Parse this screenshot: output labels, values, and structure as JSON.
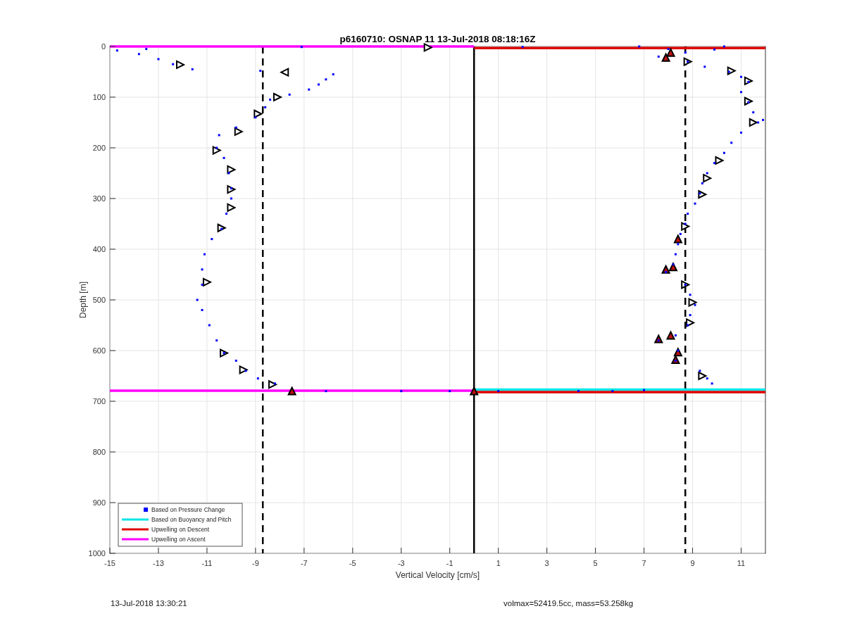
{
  "figure": {
    "chart_data": {
      "type": "scatter",
      "title": "p6160710: OSNAP 11 13-Jul-2018 08:18:16Z",
      "xlabel": "Vertical Velocity [cm/s]",
      "ylabel": "Depth [m]",
      "xlim": [
        -15,
        12
      ],
      "ylim": [
        1000,
        0
      ],
      "grid": true,
      "legend": true,
      "xticks": [
        -15,
        -13,
        -11,
        -9,
        -7,
        -5,
        -3,
        -1,
        1,
        3,
        5,
        7,
        9,
        11
      ],
      "yticks": [
        0,
        100,
        200,
        300,
        400,
        500,
        600,
        700,
        800,
        900,
        1000
      ],
      "x": [
        -15,
        0,
        0,
        12,
        0,
        12,
        0,
        12,
        -15,
        0,
        -1.9,
        -12.1,
        -8.1,
        -8.9,
        -9.7,
        -10.6,
        -10.0,
        -10.0,
        -10.0,
        -10.4,
        -11.0,
        -10.3,
        -9.5,
        -8.3,
        8.8,
        10.6,
        11.3,
        11.3,
        11.5,
        10.1,
        9.6,
        9.4,
        8.7,
        8.7,
        9.0,
        8.9,
        9.4,
        -7.8,
        -7.5,
        0,
        8.1,
        7.9,
        8.4,
        8.2,
        7.9,
        8.1,
        7.6,
        8.4,
        8.3,
        8.0,
        7.6,
        8.8,
        9.5,
        10.5,
        11.0,
        11.3,
        11.0,
        11.3,
        11.5,
        11.7,
        11.0,
        10.6,
        10.3,
        9.9,
        9.6,
        9.4,
        9.3,
        9.1,
        8.8,
        8.7,
        8.5,
        8.4,
        8.3,
        8.2,
        7.9,
        8.7,
        8.9,
        9.1,
        8.9,
        8.8,
        8.3,
        7.6,
        8.4,
        8.3,
        9.3,
        9.6,
        9.8,
        -8.2,
        -8.9,
        -9.4,
        -9.8,
        -10.3,
        -10.6,
        -10.9,
        -11.2,
        -11.4,
        -11.2,
        -11.2,
        -11.1,
        -10.8,
        -10.4,
        -10.2,
        -10.0,
        -10.0,
        -10.1,
        -10.3,
        -10.6,
        -10.5,
        -9.8,
        -9.0,
        -8.6,
        -8.4,
        -7.6,
        -6.8,
        -6.4,
        -6.1,
        -5.8,
        -11.6,
        -12.4,
        -13.0,
        -13.8,
        -14.7,
        -13.5,
        -6.1,
        -3.0,
        -1.0,
        1.0,
        4.3,
        5.7,
        7.0,
        -7.1,
        2.0,
        6.8,
        10.3,
        -8.8,
        8.7,
        9.9,
        11.9
      ],
      "series": [
        {
          "name": "Based on Pressure Change",
          "type": "scatter",
          "marker": "square",
          "color": "#0000ff",
          "values": [
            null,
            null,
            null,
            null,
            null,
            null,
            null,
            null,
            null,
            null,
            null,
            null,
            null,
            null,
            null,
            null,
            null,
            null,
            null,
            null,
            null,
            null,
            null,
            null,
            null,
            null,
            null,
            null,
            null,
            null,
            null,
            null,
            null,
            null,
            null,
            null,
            null,
            null,
            null,
            null,
            null,
            null,
            null,
            null,
            null,
            null,
            null,
            null,
            null,
            5,
            20,
            30,
            40,
            50,
            60,
            70,
            90,
            110,
            130,
            150,
            170,
            190,
            210,
            230,
            250,
            270,
            290,
            310,
            330,
            350,
            370,
            390,
            410,
            430,
            445,
            470,
            490,
            510,
            530,
            550,
            570,
            580,
            600,
            620,
            640,
            655,
            665,
            665,
            655,
            640,
            620,
            605,
            580,
            550,
            520,
            500,
            470,
            440,
            410,
            380,
            360,
            330,
            300,
            280,
            250,
            220,
            200,
            175,
            160,
            140,
            120,
            105,
            95,
            85,
            75,
            65,
            55,
            45,
            35,
            25,
            15,
            8,
            5,
            680,
            680,
            680,
            680,
            680,
            680,
            678,
            1,
            1,
            0,
            0,
            48,
            12,
            6,
            145
          ]
        },
        {
          "name": "Based on Buoyancy and Pitch",
          "type": "line",
          "color": "#00e5e5",
          "values": [
            null,
            null,
            null,
            null,
            677,
            677,
            null,
            null,
            null,
            null,
            null,
            null,
            null,
            null,
            null,
            null,
            null,
            null,
            null,
            null,
            null,
            null,
            null,
            null,
            null,
            null,
            null,
            null,
            null,
            null,
            null,
            null,
            null,
            null,
            null,
            null,
            null,
            null,
            null,
            null,
            null,
            null,
            null,
            null,
            null,
            null,
            null,
            null,
            null,
            null,
            null,
            null,
            null,
            null,
            null,
            null,
            null,
            null,
            null,
            null,
            null,
            null,
            null,
            null,
            null,
            null,
            null,
            null,
            null,
            null,
            null,
            null,
            null,
            null,
            null,
            null,
            null,
            null,
            null,
            null,
            null,
            null,
            null,
            null,
            null,
            null,
            null,
            null,
            null,
            null,
            null,
            null,
            null,
            null,
            null,
            null,
            null,
            null,
            null,
            null,
            null,
            null,
            null,
            null,
            null,
            null,
            null,
            null,
            null,
            null,
            null,
            null,
            null,
            null,
            null,
            null,
            null,
            null,
            null,
            null,
            null,
            null,
            null,
            null,
            null,
            null,
            null,
            null,
            null,
            null,
            null,
            null,
            null,
            null,
            null,
            null,
            null,
            null
          ]
        },
        {
          "name": "Upwelling on Descent",
          "type": "line",
          "color": "#e00000",
          "values": [
            null,
            null,
            3,
            3,
            null,
            null,
            null,
            null,
            null,
            null,
            null,
            null,
            null,
            null,
            null,
            null,
            null,
            null,
            null,
            null,
            null,
            null,
            null,
            null,
            null,
            null,
            null,
            null,
            null,
            null,
            null,
            null,
            null,
            null,
            null,
            null,
            null,
            null,
            null,
            null,
            null,
            null,
            null,
            null,
            null,
            null,
            null,
            null,
            null,
            null,
            null,
            null,
            null,
            null,
            null,
            null,
            null,
            null,
            null,
            null,
            null,
            null,
            null,
            null,
            null,
            null,
            null,
            null,
            null,
            null,
            null,
            null,
            null,
            null,
            null,
            null,
            null,
            null,
            null,
            null,
            null,
            null,
            null,
            null,
            null,
            null,
            null,
            null,
            null,
            null,
            null,
            null,
            null,
            null,
            null,
            null,
            null,
            null,
            null,
            null,
            null,
            null,
            null,
            null,
            null,
            null,
            null,
            null,
            null,
            null,
            null,
            null,
            null,
            null,
            null,
            null,
            null,
            null,
            null,
            null,
            null,
            null,
            null,
            null,
            null,
            null,
            null,
            null,
            null,
            null,
            null,
            null,
            null,
            null,
            null,
            null,
            null,
            null
          ]
        },
        {
          "name": "Upwelling on Ascent",
          "type": "line",
          "color": "#ff00ff",
          "values": [
            0,
            0,
            null,
            null,
            null,
            null,
            null,
            null,
            null,
            null,
            null,
            null,
            null,
            null,
            null,
            null,
            null,
            null,
            null,
            null,
            null,
            null,
            null,
            null,
            null,
            null,
            null,
            null,
            null,
            null,
            null,
            null,
            null,
            null,
            null,
            null,
            null,
            null,
            null,
            null,
            null,
            null,
            null,
            null,
            null,
            null,
            null,
            null,
            null,
            null,
            null,
            null,
            null,
            null,
            null,
            null,
            null,
            null,
            null,
            null,
            null,
            null,
            null,
            null,
            null,
            null,
            null,
            null,
            null,
            null,
            null,
            null,
            null,
            null,
            null,
            null,
            null,
            null,
            null,
            null,
            null,
            null,
            null,
            null,
            null,
            null,
            null,
            null,
            null,
            null,
            null,
            null,
            null,
            null,
            null,
            null,
            null,
            null,
            null,
            null,
            null,
            null,
            null,
            null,
            null,
            null,
            null,
            null,
            null,
            null,
            null,
            null,
            null,
            null,
            null,
            null,
            null,
            null,
            null,
            null,
            null,
            null,
            null,
            null,
            null,
            null,
            null,
            null,
            null,
            null,
            null,
            null,
            null,
            null,
            null,
            null,
            null,
            null
          ]
        },
        {
          "type": "line",
          "color": "#e00000",
          "values": [
            null,
            null,
            null,
            null,
            null,
            null,
            682,
            682,
            null,
            null,
            null,
            null,
            null,
            null,
            null,
            null,
            null,
            null,
            null,
            null,
            null,
            null,
            null,
            null,
            null,
            null,
            null,
            null,
            null,
            null,
            null,
            null,
            null,
            null,
            null,
            null,
            null,
            null,
            null,
            null,
            null,
            null,
            null,
            null,
            null,
            null,
            null,
            null,
            null,
            null,
            null,
            null,
            null,
            null,
            null,
            null,
            null,
            null,
            null,
            null,
            null,
            null,
            null,
            null,
            null,
            null,
            null,
            null,
            null,
            null,
            null,
            null,
            null,
            null,
            null,
            null,
            null,
            null,
            null,
            null,
            null,
            null,
            null,
            null,
            null,
            null,
            null,
            null,
            null,
            null,
            null,
            null,
            null,
            null,
            null,
            null,
            null,
            null,
            null,
            null,
            null,
            null,
            null,
            null,
            null,
            null,
            null,
            null,
            null,
            null,
            null,
            null,
            null,
            null,
            null,
            null,
            null,
            null,
            null,
            null,
            null,
            null,
            null,
            null,
            null,
            null,
            null,
            null,
            null,
            null,
            null,
            null,
            null,
            null,
            null,
            null,
            null,
            null
          ]
        },
        {
          "type": "line",
          "color": "#ff00ff",
          "values": [
            null,
            null,
            null,
            null,
            null,
            null,
            null,
            null,
            679,
            679,
            null,
            null,
            null,
            null,
            null,
            null,
            null,
            null,
            null,
            null,
            null,
            null,
            null,
            null,
            null,
            null,
            null,
            null,
            null,
            null,
            null,
            null,
            null,
            null,
            null,
            null,
            null,
            null,
            null,
            null,
            null,
            null,
            null,
            null,
            null,
            null,
            null,
            null,
            null,
            null,
            null,
            null,
            null,
            null,
            null,
            null,
            null,
            null,
            null,
            null,
            null,
            null,
            null,
            null,
            null,
            null,
            null,
            null,
            null,
            null,
            null,
            null,
            null,
            null,
            null,
            null,
            null,
            null,
            null,
            null,
            null,
            null,
            null,
            null,
            null,
            null,
            null,
            null,
            null,
            null,
            null,
            null,
            null,
            null,
            null,
            null,
            null,
            null,
            null,
            null,
            null,
            null,
            null,
            null,
            null,
            null,
            null,
            null,
            null,
            null,
            null,
            null,
            null,
            null,
            null,
            null,
            null,
            null,
            null,
            null,
            null,
            null,
            null,
            null,
            null,
            null,
            null,
            null,
            null,
            null,
            null,
            null,
            null,
            null,
            null,
            null,
            null,
            null
          ]
        },
        {
          "type": "scatter",
          "marker": "triangle-right",
          "color": "#ffffff",
          "values": [
            null,
            null,
            null,
            null,
            null,
            null,
            null,
            null,
            null,
            null,
            2,
            36,
            100,
            133,
            168,
            205,
            243,
            282,
            318,
            358,
            465,
            605,
            638,
            667,
            30,
            48,
            68,
            108,
            150,
            225,
            260,
            292,
            355,
            470,
            505,
            545,
            650,
            null,
            null,
            null,
            null,
            null,
            null,
            null,
            null,
            null,
            null,
            null,
            null,
            null,
            null,
            null,
            null,
            null,
            null,
            null,
            null,
            null,
            null,
            null,
            null,
            null,
            null,
            null,
            null,
            null,
            null,
            null,
            null,
            null,
            null,
            null,
            null,
            null,
            null,
            null,
            null,
            null,
            null,
            null,
            null,
            null,
            null,
            null,
            null,
            null,
            null,
            null,
            null,
            null,
            null,
            null,
            null,
            null,
            null,
            null,
            null,
            null,
            null,
            null,
            null,
            null,
            null,
            null,
            null,
            null,
            null,
            null,
            null,
            null,
            null,
            null,
            null,
            null,
            null,
            null,
            null,
            null,
            null,
            null,
            null,
            null,
            null,
            null,
            null,
            null,
            null,
            null,
            null,
            null,
            null,
            null,
            null,
            null,
            null,
            null,
            null,
            null
          ]
        },
        {
          "type": "scatter",
          "marker": "triangle-left",
          "color": "#ffffff",
          "values": [
            null,
            null,
            null,
            null,
            null,
            null,
            null,
            null,
            null,
            null,
            null,
            null,
            null,
            null,
            null,
            null,
            null,
            null,
            null,
            null,
            null,
            null,
            null,
            null,
            null,
            null,
            null,
            null,
            null,
            null,
            null,
            null,
            null,
            null,
            null,
            null,
            null,
            51,
            null,
            null,
            null,
            null,
            null,
            null,
            null,
            null,
            null,
            null,
            null,
            null,
            null,
            null,
            null,
            null,
            null,
            null,
            null,
            null,
            null,
            null,
            null,
            null,
            null,
            null,
            null,
            null,
            null,
            null,
            null,
            null,
            null,
            null,
            null,
            null,
            null,
            null,
            null,
            null,
            null,
            null,
            null,
            null,
            null,
            null,
            null,
            null,
            null,
            null,
            null,
            null,
            null,
            null,
            null,
            null,
            null,
            null,
            null,
            null,
            null,
            null,
            null,
            null,
            null,
            null,
            null,
            null,
            null,
            null,
            null,
            null,
            null,
            null,
            null,
            null,
            null,
            null,
            null,
            null,
            null,
            null,
            null,
            null,
            null,
            null,
            null,
            null,
            null,
            null,
            null,
            null,
            null,
            null,
            null,
            null,
            null,
            null,
            null,
            null
          ]
        },
        {
          "type": "scatter",
          "marker": "triangle-up",
          "color": "#c01010",
          "values": [
            null,
            null,
            null,
            null,
            null,
            null,
            null,
            null,
            null,
            null,
            null,
            null,
            null,
            null,
            null,
            null,
            null,
            null,
            null,
            null,
            null,
            null,
            null,
            null,
            null,
            null,
            null,
            null,
            null,
            null,
            null,
            null,
            null,
            null,
            null,
            null,
            null,
            null,
            680,
            680,
            12,
            22,
            380,
            435,
            440,
            570,
            577,
            603,
            618,
            null,
            null,
            null,
            null,
            null,
            null,
            null,
            null,
            null,
            null,
            null,
            null,
            null,
            null,
            null,
            null,
            null,
            null,
            null,
            null,
            null,
            null,
            null,
            null,
            null,
            null,
            null,
            null,
            null,
            null,
            null,
            null,
            null,
            null,
            null,
            null,
            null,
            null,
            null,
            null,
            null,
            null,
            null,
            null,
            null,
            null,
            null,
            null,
            null,
            null,
            null,
            null,
            null,
            null,
            null,
            null,
            null,
            null,
            null,
            null,
            null,
            null,
            null,
            null,
            null,
            null,
            null,
            null,
            null,
            null,
            null,
            null,
            null,
            null,
            null,
            null,
            null,
            null,
            null,
            null,
            null,
            null,
            null,
            null,
            null,
            null,
            null,
            null,
            null
          ]
        }
      ],
      "ref_lines": [
        {
          "axis": "x",
          "value": -8.7
        },
        {
          "axis": "x",
          "value": 8.7
        },
        {
          "axis": "x",
          "value": 0
        }
      ]
    }
  },
  "footer": {
    "timestamp": "13-Jul-2018 13:30:21",
    "parameters": "volmax=52419.5cc, mass=53.258kg"
  }
}
